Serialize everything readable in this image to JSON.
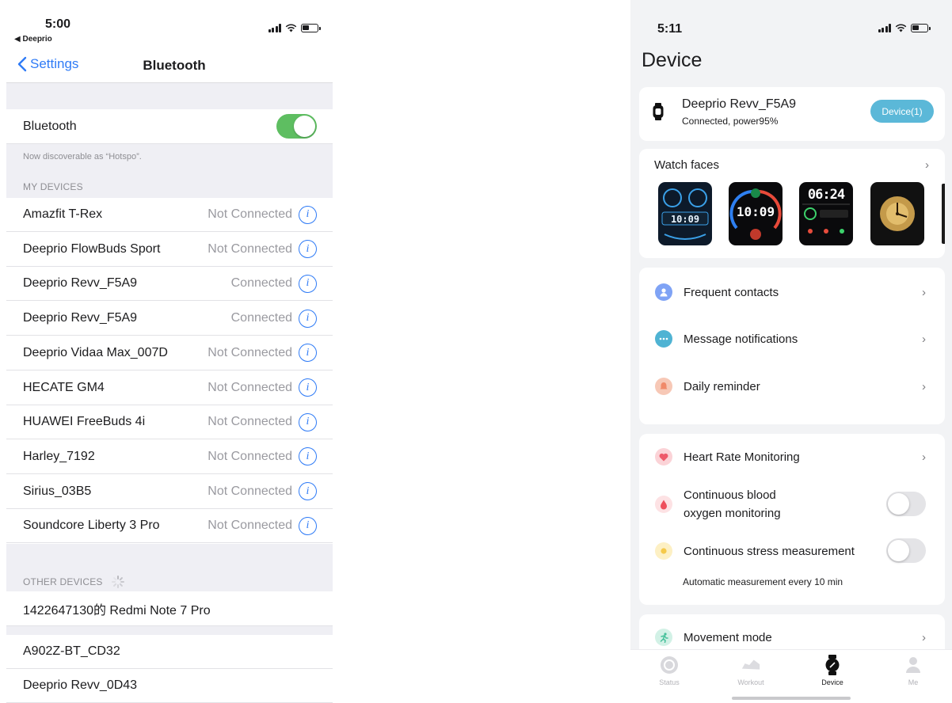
{
  "left": {
    "status_bar": {
      "time": "5:00",
      "back_app": "◀ Deeprio"
    },
    "nav": {
      "back_label": "Settings",
      "title": "Bluetooth"
    },
    "bluetooth": {
      "label": "Bluetooth",
      "enabled": true,
      "toggle_color": "#5ebe61"
    },
    "discoverable_note": "Now discoverable as “Hotspo”.",
    "my_devices_header": "MY DEVICES",
    "my_devices": [
      {
        "name": "Amazfit T-Rex",
        "status": "Not Connected"
      },
      {
        "name": "Deeprio FlowBuds Sport",
        "status": "Not Connected"
      },
      {
        "name": "Deeprio Revv_F5A9",
        "status": "Connected"
      },
      {
        "name": "Deeprio Revv_F5A9",
        "status": "Connected"
      },
      {
        "name": "Deeprio Vidaa Max_007D",
        "status": "Not Connected"
      },
      {
        "name": "HECATE GM4",
        "status": "Not Connected"
      },
      {
        "name": "HUAWEI FreeBuds 4i",
        "status": "Not Connected"
      },
      {
        "name": "Harley_7192",
        "status": "Not Connected"
      },
      {
        "name": "Sirius_03B5",
        "status": "Not Connected"
      },
      {
        "name": "Soundcore Liberty 3 Pro",
        "status": "Not Connected"
      }
    ],
    "other_devices_header": "OTHER DEVICES",
    "other_devices": [
      {
        "name": "1422647130的 Redmi Note 7 Pro"
      },
      {
        "name": "A902Z-BT_CD32"
      },
      {
        "name": "Deeprio Revv_0D43"
      }
    ],
    "accent_color": "#2f7bf6"
  },
  "right": {
    "status_bar": {
      "time": "5:11"
    },
    "page_title": "Device",
    "device": {
      "name": "Deeprio Revv_F5A9",
      "status": "Connected, power95%",
      "button_label": "Device(1)",
      "button_color": "#5bb8d8"
    },
    "watch_faces": {
      "title": "Watch faces",
      "faces": [
        {
          "time": "10:09",
          "theme": "blue"
        },
        {
          "time": "10:09",
          "theme": "color"
        },
        {
          "time": "06:24",
          "theme": "digital"
        },
        {
          "time": "",
          "theme": "gold-analog"
        }
      ]
    },
    "menu_group_1": [
      {
        "label": "Frequent contacts",
        "icon": "person-icon",
        "color": "#7fa3f5"
      },
      {
        "label": "Message notifications",
        "icon": "chat-icon",
        "color": "#4fb3d3"
      },
      {
        "label": "Daily reminder",
        "icon": "bell-icon",
        "color": "#f08a6a"
      }
    ],
    "menu_group_2": {
      "heart_rate": {
        "label": "Heart Rate Monitoring",
        "color": "#ee5a6a"
      },
      "blood_oxygen": {
        "label_line1": "Continuous blood",
        "label_line2": "oxygen monitoring",
        "enabled": false,
        "color": "#ee4f5c"
      },
      "stress": {
        "label": "Continuous stress measurement",
        "enabled": false,
        "note": "Automatic measurement every 10 min",
        "color": "#f5c94a"
      }
    },
    "movement_mode": {
      "label": "Movement mode",
      "color": "#45c09a"
    },
    "tabs": [
      {
        "label": "Status",
        "icon": "status-icon",
        "active": false
      },
      {
        "label": "Workout",
        "icon": "shoe-icon",
        "active": false
      },
      {
        "label": "Device",
        "icon": "watch-icon",
        "active": true
      },
      {
        "label": "Me",
        "icon": "person-icon",
        "active": false
      }
    ]
  }
}
